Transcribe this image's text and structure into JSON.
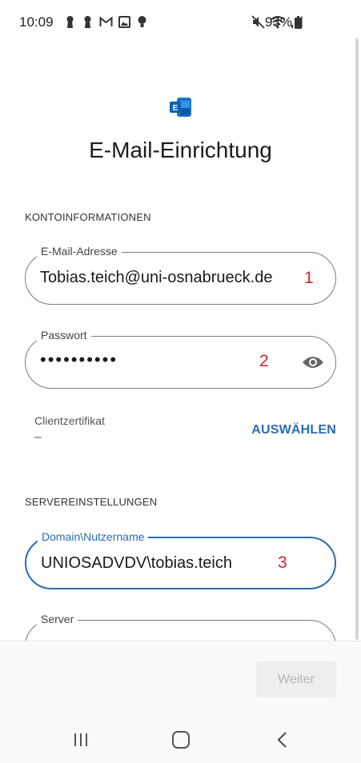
{
  "status_bar": {
    "time": "10:09",
    "battery": "93%",
    "left_icons": [
      "keyhole-icon",
      "keyhole-icon",
      "gmail-icon",
      "gallery-icon",
      "lightbulb-icon"
    ],
    "right_icons": [
      "mute-icon",
      "wifi-icon",
      "signal-icon",
      "battery-icon"
    ]
  },
  "header": {
    "logo": "exchange-logo-icon",
    "title": "E-Mail-Einrichtung"
  },
  "account_section": {
    "label": "KONTOINFORMATIONEN",
    "email": {
      "label": "E-Mail-Adresse",
      "value": "Tobias.teich@uni-osnabrueck.de",
      "annotation": "1"
    },
    "password": {
      "label": "Passwort",
      "value": "••••••••••",
      "annotation": "2",
      "toggle_icon": "eye-icon"
    },
    "client_cert": {
      "label": "Clientzertifikat",
      "value": "–",
      "action": "AUSWÄHLEN"
    }
  },
  "server_section": {
    "label": "SERVEREINSTELLUNGEN",
    "domain_user": {
      "label": "Domain\\Nutzername",
      "value": "UNIOSADVDV\\tobias.teich",
      "annotation": "3"
    },
    "server": {
      "label": "Server"
    }
  },
  "footer": {
    "next_label": "Weiter"
  },
  "colors": {
    "accent": "#2b6cb0",
    "annotation": "#d0222a",
    "disabled_button_bg": "#eeeeee",
    "disabled_button_text": "#b5b5b5"
  }
}
